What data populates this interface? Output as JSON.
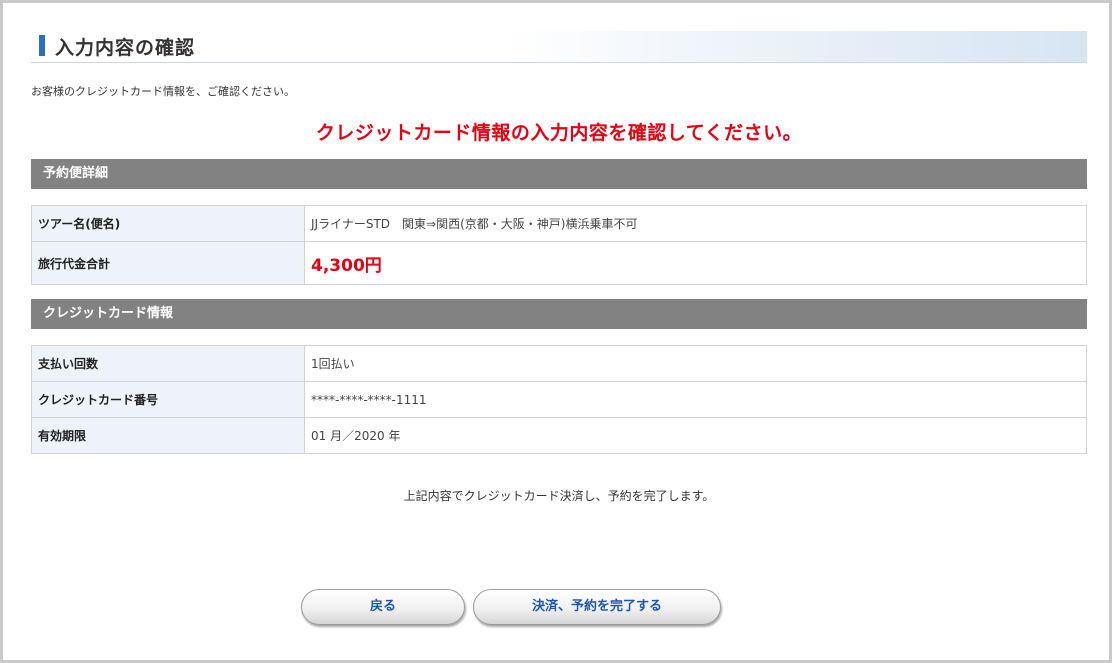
{
  "header": {
    "title": "入力内容の確認"
  },
  "intro": "お客様のクレジットカード情報を、ご確認ください。",
  "notice": "クレジットカード情報の入力内容を確認してください。",
  "reservation": {
    "heading": "予約便詳細",
    "rows": [
      {
        "label": "ツアー名(便名)",
        "value": "JJライナーSTD　関東⇒関西(京都・大阪・神戸)横浜乗車不可"
      },
      {
        "label": "旅行代金合計",
        "value": "4,300円"
      }
    ]
  },
  "card": {
    "heading": "クレジットカード情報",
    "rows": [
      {
        "label": "支払い回数",
        "value": "1回払い"
      },
      {
        "label": "クレジットカード番号",
        "value": "****-****-****-1111"
      },
      {
        "label": "有効期限",
        "value": "01 月／2020 年"
      }
    ]
  },
  "note": "上記内容でクレジットカード決済し、予約を完了します。",
  "buttons": {
    "back": "戻る",
    "complete": "決済、予約を完了する"
  }
}
